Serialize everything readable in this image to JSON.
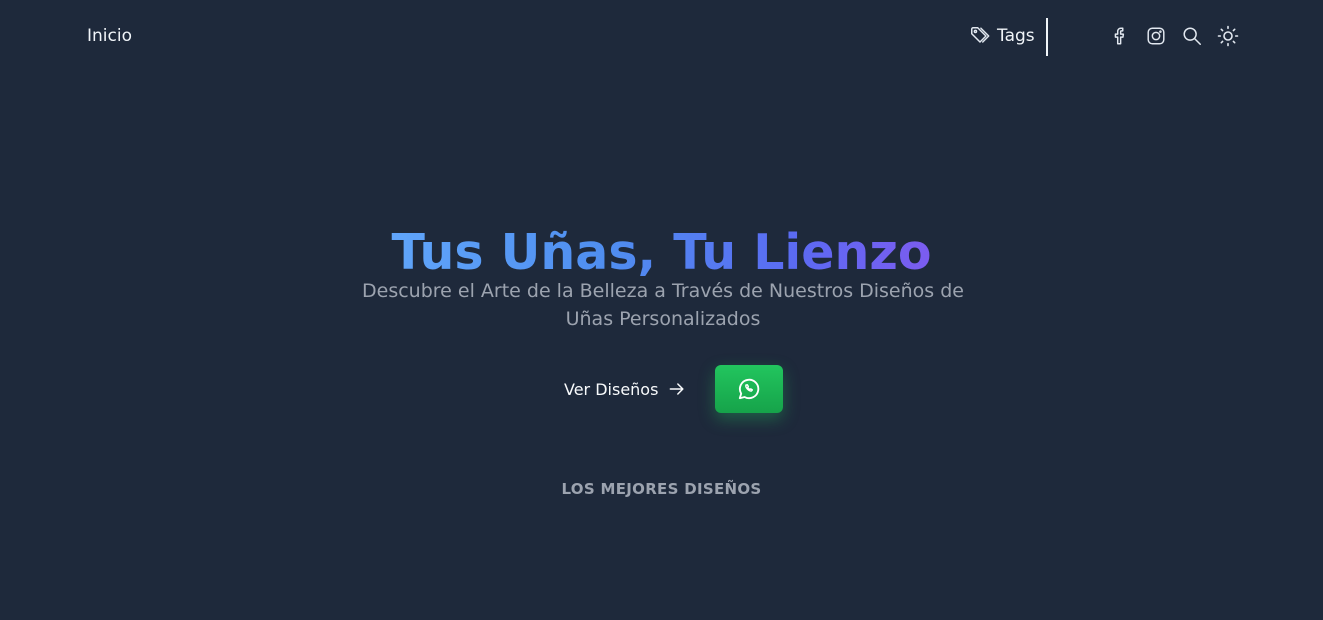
{
  "header": {
    "brand": "Inicio",
    "tags_label": "Tags",
    "icons": [
      "tag-icon",
      "facebook-icon",
      "instagram-icon",
      "search-icon",
      "sun-icon"
    ]
  },
  "hero": {
    "title": "Tus Uñas, Tu Lienzo",
    "subtitle": "Descubre el Arte de la Belleza a Través de Nuestros Diseños de Uñas Personalizados",
    "cta_label": "Ver Diseños",
    "whatsapp_icon": "whatsapp-icon"
  },
  "section": {
    "label": "LOS MEJORES DISEÑOS"
  },
  "colors": {
    "background": "#1e293b",
    "title_gradient_start": "#60a5fa",
    "title_gradient_end": "#7c5cf0",
    "whatsapp_green": "#22c55e",
    "muted_text": "#9ca3af"
  }
}
